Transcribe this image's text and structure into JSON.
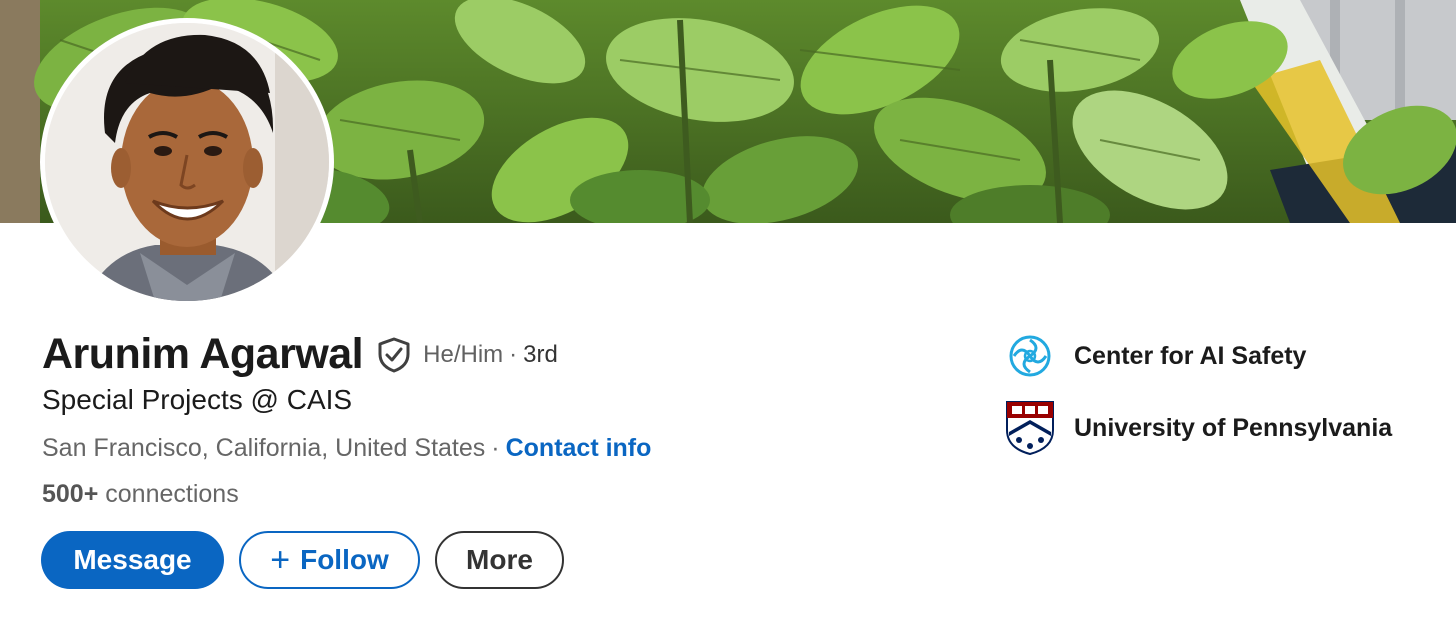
{
  "profile": {
    "name": "Arunim Agarwal",
    "pronouns": "He/Him",
    "separator": "·",
    "degree": "3rd",
    "headline": "Special Projects @ CAIS",
    "location": "San Francisco, California, United States",
    "contact_label": "Contact info",
    "connections_count": "500+",
    "connections_label": "connections"
  },
  "actions": {
    "message_label": "Message",
    "follow_plus": "+",
    "follow_label": "Follow",
    "more_label": "More"
  },
  "organizations": [
    {
      "name": "Center for AI Safety",
      "icon": "cais-logo-icon"
    },
    {
      "name": "University of Pennsylvania",
      "icon": "upenn-shield-icon"
    }
  ],
  "colors": {
    "brand_blue": "#0a66c2",
    "cais_cyan": "#22a9e0",
    "penn_red": "#990000",
    "penn_navy": "#011f5b"
  }
}
